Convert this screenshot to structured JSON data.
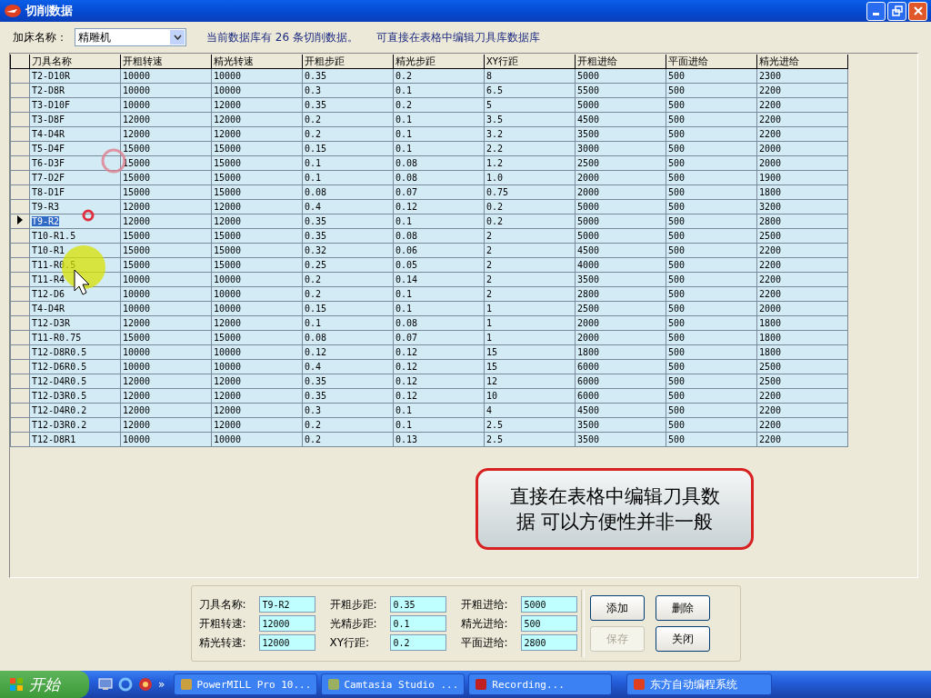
{
  "window": {
    "title": "切削数据"
  },
  "toolbar": {
    "machine_label": "加床名称：",
    "machine_value": "精雕机",
    "info": "当前数据库有 26 条切削数据。",
    "hint": "可直接在表格中编辑刀具库数据库"
  },
  "table": {
    "columns": [
      "刀具名称",
      "开粗转速",
      "精光转速",
      "开粗步距",
      "精光步距",
      "XY行距",
      "开粗进给",
      "平面进给",
      "精光进给"
    ],
    "rows": [
      {
        "selected": false,
        "cells": [
          "T2-D10R",
          "10000",
          "10000",
          "0.35",
          "0.2",
          "8",
          "5000",
          "500",
          "2300"
        ]
      },
      {
        "selected": false,
        "cells": [
          "T2-D8R",
          "10000",
          "10000",
          "0.3",
          "0.1",
          "6.5",
          "5500",
          "500",
          "2200"
        ]
      },
      {
        "selected": false,
        "cells": [
          "T3-D10F",
          "10000",
          "12000",
          "0.35",
          "0.2",
          "5",
          "5000",
          "500",
          "2200"
        ]
      },
      {
        "selected": false,
        "cells": [
          "T3-D8F",
          "12000",
          "12000",
          "0.2",
          "0.1",
          "3.5",
          "4500",
          "500",
          "2200"
        ]
      },
      {
        "selected": false,
        "cells": [
          "T4-D4R",
          "12000",
          "12000",
          "0.2",
          "0.1",
          "3.2",
          "3500",
          "500",
          "2200"
        ]
      },
      {
        "selected": false,
        "cells": [
          "T5-D4F",
          "15000",
          "15000",
          "0.15",
          "0.1",
          "2.2",
          "3000",
          "500",
          "2000"
        ]
      },
      {
        "selected": false,
        "cells": [
          "T6-D3F",
          "15000",
          "15000",
          "0.1",
          "0.08",
          "1.2",
          "2500",
          "500",
          "2000"
        ]
      },
      {
        "selected": false,
        "cells": [
          "T7-D2F",
          "15000",
          "15000",
          "0.1",
          "0.08",
          "1.0",
          "2000",
          "500",
          "1900"
        ]
      },
      {
        "selected": false,
        "cells": [
          "T8-D1F",
          "15000",
          "15000",
          "0.08",
          "0.07",
          "0.75",
          "2000",
          "500",
          "1800"
        ]
      },
      {
        "selected": false,
        "cells": [
          "T9-R3",
          "12000",
          "12000",
          "0.4",
          "0.12",
          "0.2",
          "5000",
          "500",
          "3200"
        ]
      },
      {
        "selected": true,
        "cells": [
          "T9-R2",
          "12000",
          "12000",
          "0.35",
          "0.1",
          "0.2",
          "5000",
          "500",
          "2800"
        ]
      },
      {
        "selected": false,
        "cells": [
          "T10-R1.5",
          "15000",
          "15000",
          "0.35",
          "0.08",
          "2",
          "5000",
          "500",
          "2500"
        ]
      },
      {
        "selected": false,
        "cells": [
          "T10-R1",
          "15000",
          "15000",
          "0.32",
          "0.06",
          "2",
          "4500",
          "500",
          "2200"
        ]
      },
      {
        "selected": false,
        "cells": [
          "T11-R0.5",
          "15000",
          "15000",
          "0.25",
          "0.05",
          "2",
          "4000",
          "500",
          "2200"
        ]
      },
      {
        "selected": false,
        "cells": [
          "T11-R4",
          "10000",
          "10000",
          "0.2",
          "0.14",
          "2",
          "3500",
          "500",
          "2200"
        ]
      },
      {
        "selected": false,
        "cells": [
          "T12-D6",
          "10000",
          "10000",
          "0.2",
          "0.1",
          "2",
          "2800",
          "500",
          "2200"
        ]
      },
      {
        "selected": false,
        "cells": [
          "T4-D4R",
          "10000",
          "10000",
          "0.15",
          "0.1",
          "1",
          "2500",
          "500",
          "2000"
        ]
      },
      {
        "selected": false,
        "cells": [
          "T12-D3R",
          "12000",
          "12000",
          "0.1",
          "0.08",
          "1",
          "2000",
          "500",
          "1800"
        ]
      },
      {
        "selected": false,
        "cells": [
          "T11-R0.75",
          "15000",
          "15000",
          "0.08",
          "0.07",
          "1",
          "2000",
          "500",
          "1800"
        ]
      },
      {
        "selected": false,
        "cells": [
          "T12-D8R0.5",
          "10000",
          "10000",
          "0.12",
          "0.12",
          "15",
          "1800",
          "500",
          "1800"
        ]
      },
      {
        "selected": false,
        "cells": [
          "T12-D6R0.5",
          "10000",
          "10000",
          "0.4",
          "0.12",
          "15",
          "6000",
          "500",
          "2500"
        ]
      },
      {
        "selected": false,
        "cells": [
          "T12-D4R0.5",
          "12000",
          "12000",
          "0.35",
          "0.12",
          "12",
          "6000",
          "500",
          "2500"
        ]
      },
      {
        "selected": false,
        "cells": [
          "T12-D3R0.5",
          "12000",
          "12000",
          "0.35",
          "0.12",
          "10",
          "6000",
          "500",
          "2200"
        ]
      },
      {
        "selected": false,
        "cells": [
          "T12-D4R0.2",
          "12000",
          "12000",
          "0.3",
          "0.1",
          "4",
          "4500",
          "500",
          "2200"
        ]
      },
      {
        "selected": false,
        "cells": [
          "T12-D3R0.2",
          "12000",
          "12000",
          "0.2",
          "0.1",
          "2.5",
          "3500",
          "500",
          "2200"
        ]
      },
      {
        "selected": false,
        "cells": [
          "T12-D8R1",
          "10000",
          "10000",
          "0.2",
          "0.13",
          "2.5",
          "3500",
          "500",
          "2200"
        ]
      }
    ]
  },
  "callout": {
    "text": "直接在表格中编辑刀具数据 可以方便性并非一般"
  },
  "form": {
    "fields": [
      {
        "label": "刀具名称:",
        "value": "T9-R2"
      },
      {
        "label": "开粗转速:",
        "value": "12000"
      },
      {
        "label": "精光转速:",
        "value": "12000"
      },
      {
        "label": "开粗步距:",
        "value": "0.35"
      },
      {
        "label": "光精步距:",
        "value": "0.1"
      },
      {
        "label": "XY行距:",
        "value": "0.2"
      },
      {
        "label": "开粗进给:",
        "value": "5000"
      },
      {
        "label": "精光进给:",
        "value": "500"
      },
      {
        "label": "平面进给:",
        "value": "2800"
      }
    ],
    "buttons": [
      {
        "label": "添加",
        "disabled": false
      },
      {
        "label": "删除",
        "disabled": false
      },
      {
        "label": "保存",
        "disabled": true
      },
      {
        "label": "关闭",
        "disabled": false
      }
    ]
  },
  "taskbar": {
    "start": "开始",
    "overflow": "»",
    "tasks": [
      {
        "label": "PowerMILL Pro 10..."
      },
      {
        "label": "Camtasia Studio ..."
      },
      {
        "label": "Recording..."
      },
      {
        "label": "东方自动编程系统"
      }
    ]
  }
}
